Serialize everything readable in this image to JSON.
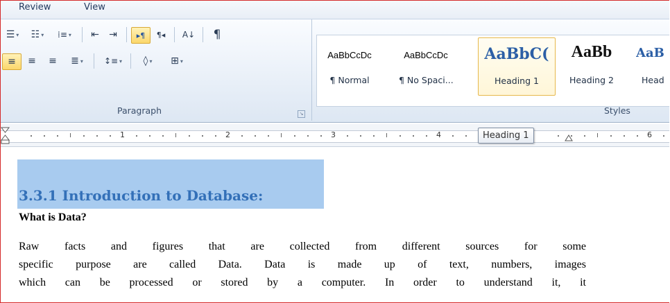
{
  "tabs": [
    "Review",
    "View"
  ],
  "ribbon": {
    "paragraph": {
      "label": "Paragraph",
      "row1": [
        {
          "icon": "bullets-icon",
          "glyph": "☰",
          "dropdown": true
        },
        {
          "icon": "numbering-icon",
          "glyph": "☷",
          "dropdown": true
        },
        {
          "icon": "multilevel-list-icon",
          "glyph": "⁞≡",
          "dropdown": true
        },
        {
          "icon": "decrease-indent-icon",
          "glyph": "⇤"
        },
        {
          "icon": "increase-indent-icon",
          "glyph": "⇥"
        },
        {
          "icon": "ltr-icon",
          "glyph": "▸¶",
          "selected": true
        },
        {
          "icon": "rtl-icon",
          "glyph": "¶◂"
        },
        {
          "icon": "sort-icon",
          "glyph": "A↓"
        },
        {
          "icon": "show-formatting-icon",
          "glyph": "¶"
        }
      ],
      "row2": [
        {
          "icon": "align-left-icon",
          "glyph": "≡",
          "selected": true
        },
        {
          "icon": "align-center-icon",
          "glyph": "≡"
        },
        {
          "icon": "align-right-icon",
          "glyph": "≡"
        },
        {
          "icon": "justify-icon",
          "glyph": "≣",
          "dropdown": true
        },
        {
          "icon": "line-spacing-icon",
          "glyph": "↕≡",
          "dropdown": true
        },
        {
          "icon": "shading-icon",
          "glyph": "◊",
          "dropdown": true
        },
        {
          "icon": "borders-icon",
          "glyph": "⊞",
          "dropdown": true
        }
      ]
    },
    "styles": {
      "label": "Styles",
      "items": [
        {
          "sample": "AaBbCcDc",
          "name": "¶ Normal"
        },
        {
          "sample": "AaBbCcDc",
          "name": "¶ No Spaci..."
        },
        {
          "sample": "AaBbC(",
          "name": "Heading 1",
          "selected": true
        },
        {
          "sample": "AaBb",
          "name": "Heading 2"
        },
        {
          "sample": "AaB",
          "name": "Head"
        }
      ]
    }
  },
  "ruler": {
    "numbers": [
      "1",
      "2",
      "3",
      "4",
      "6"
    ]
  },
  "tooltip": "Heading 1",
  "document": {
    "heading": "3.3.1 Introduction to Database:",
    "subheading": "What is Data?",
    "paragraph_lines": [
      "Raw facts and figures that are collected from different sources for some",
      "specific purpose are called Data. Data is made up of text, numbers, images",
      "which can be processed or stored by a computer. In order to understand it, it"
    ]
  },
  "colors": {
    "accent_heading": "#3370b8",
    "selection": "#a8cbef",
    "frame": "#d42a2a"
  }
}
